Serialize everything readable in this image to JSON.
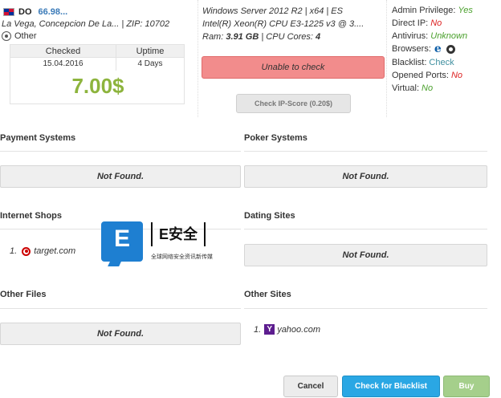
{
  "location": {
    "country": "DO",
    "ip": "66.98...",
    "address": "La Vega, Concepcion De La... | ZIP: 10702",
    "os_label": "Other"
  },
  "stats": {
    "checked_label": "Checked",
    "uptime_label": "Uptime",
    "checked_value": "15.04.2016",
    "uptime_value": "4 Days",
    "price": "7.00$",
    "price_color": "#8db43d"
  },
  "system": {
    "os": "Windows Server 2012 R2 | x64 | ES",
    "cpu": "Intel(R) Xeon(R) CPU E3-1225 v3 @ 3....",
    "ram_label": "Ram:",
    "ram_value": "3.91 GB",
    "cores_label": "| CPU Cores:",
    "cores_value": "4",
    "unable_label": "Unable to check",
    "ipscore_label": "Check IP-Score (0.20$)"
  },
  "props": {
    "admin_label": "Admin Privilege:",
    "admin_value": "Yes",
    "directip_label": "Direct IP:",
    "directip_value": "No",
    "antivirus_label": "Antivirus:",
    "antivirus_value": "Unknown",
    "browsers_label": "Browsers:",
    "blacklist_label": "Blacklist:",
    "blacklist_value": "Check",
    "ports_label": "Opened Ports:",
    "ports_value": "No",
    "virtual_label": "Virtual:",
    "virtual_value": "No"
  },
  "sections": {
    "payment_title": "Payment Systems",
    "payment_result": "Not Found.",
    "poker_title": "Poker Systems",
    "poker_result": "Not Found.",
    "shops_title": "Internet Shops",
    "shops_item_num": "1.",
    "shops_item": "target.com",
    "dating_title": "Dating Sites",
    "dating_result": "Not Found.",
    "files_title": "Other Files",
    "files_result": "Not Found.",
    "othersites_title": "Other Sites",
    "othersites_item_num": "1.",
    "othersites_item": "yahoo.com"
  },
  "watermark": {
    "letter": "E",
    "brand": "E安全",
    "tagline": "全球网络安全资讯新传媒"
  },
  "buttons": {
    "cancel": "Cancel",
    "blacklist": "Check for Blacklist",
    "buy": "Buy"
  },
  "colors": {
    "green": "#4aa02c",
    "red": "#dd2222",
    "accent_blue": "#2aa7e4",
    "unable_red": "#f28c8c"
  }
}
